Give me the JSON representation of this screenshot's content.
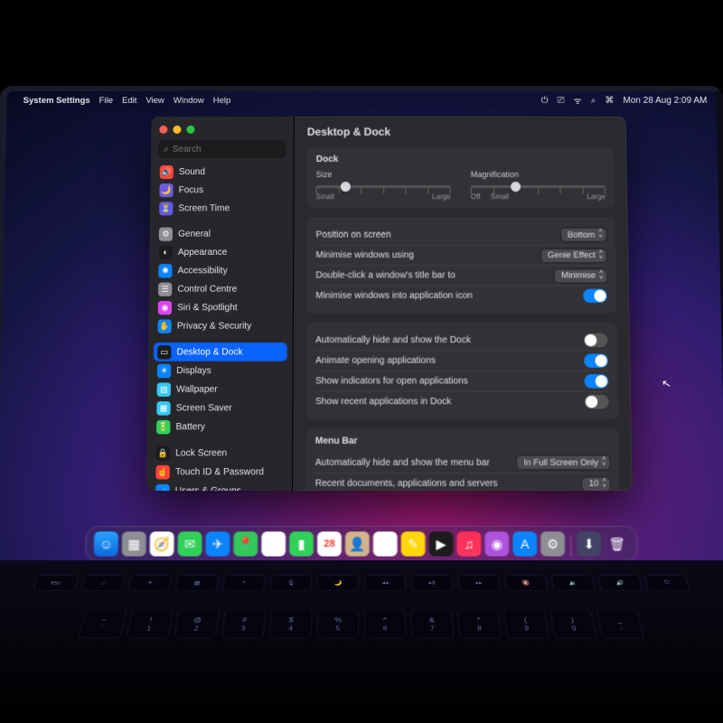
{
  "menubar": {
    "app_name": "System Settings",
    "items": [
      "File",
      "Edit",
      "View",
      "Window",
      "Help"
    ],
    "clock": "Mon 28 Aug  2:09 AM"
  },
  "window": {
    "title": "Desktop & Dock",
    "search_placeholder": "Search"
  },
  "sidebar": {
    "groups": [
      [
        {
          "label": "Sound",
          "color": "#ff453a",
          "glyph": "🔊"
        },
        {
          "label": "Focus",
          "color": "#6e5ce6",
          "glyph": "🌙"
        },
        {
          "label": "Screen Time",
          "color": "#5e5ce6",
          "glyph": "⏳"
        }
      ],
      [
        {
          "label": "General",
          "color": "#8e8e93",
          "glyph": "⚙"
        },
        {
          "label": "Appearance",
          "color": "#1c1c1e",
          "glyph": "◐"
        },
        {
          "label": "Accessibility",
          "color": "#0a84ff",
          "glyph": "✺"
        },
        {
          "label": "Control Centre",
          "color": "#8e8e93",
          "glyph": "☰"
        },
        {
          "label": "Siri & Spotlight",
          "color": "#d946ef",
          "glyph": "◉"
        },
        {
          "label": "Privacy & Security",
          "color": "#0a84ff",
          "glyph": "✋"
        }
      ],
      [
        {
          "label": "Desktop & Dock",
          "color": "#1c1c1e",
          "glyph": "▭",
          "selected": true
        },
        {
          "label": "Displays",
          "color": "#0a84ff",
          "glyph": "☀"
        },
        {
          "label": "Wallpaper",
          "color": "#34c7f5",
          "glyph": "▧"
        },
        {
          "label": "Screen Saver",
          "color": "#34c7f5",
          "glyph": "▦"
        },
        {
          "label": "Battery",
          "color": "#30d158",
          "glyph": "🔋"
        }
      ],
      [
        {
          "label": "Lock Screen",
          "color": "#1c1c1e",
          "glyph": "🔒"
        },
        {
          "label": "Touch ID & Password",
          "color": "#ff453a",
          "glyph": "☝"
        },
        {
          "label": "Users & Groups",
          "color": "#0a84ff",
          "glyph": "👥"
        }
      ]
    ]
  },
  "dock_section": {
    "heading": "Dock",
    "size": {
      "label": "Size",
      "min": "Small",
      "max": "Large",
      "pos": 18
    },
    "mag": {
      "label": "Magnification",
      "min_off": "Off",
      "min": "Small",
      "max": "Large",
      "pos": 30
    }
  },
  "rows1": [
    {
      "label": "Position on screen",
      "value": "Bottom",
      "type": "popup"
    },
    {
      "label": "Minimise windows using",
      "value": "Genie Effect",
      "type": "popup"
    },
    {
      "label": "Double-click a window's title bar to",
      "value": "Minimise",
      "type": "popup"
    },
    {
      "label": "Minimise windows into application icon",
      "on": true,
      "type": "toggle"
    }
  ],
  "rows2": [
    {
      "label": "Automatically hide and show the Dock",
      "on": false,
      "type": "toggle"
    },
    {
      "label": "Animate opening applications",
      "on": true,
      "type": "toggle"
    },
    {
      "label": "Show indicators for open applications",
      "on": true,
      "type": "toggle"
    },
    {
      "label": "Show recent applications in Dock",
      "on": false,
      "type": "toggle"
    }
  ],
  "menubar_section": {
    "heading": "Menu Bar",
    "rows": [
      {
        "label": "Automatically hide and show the menu bar",
        "value": "In Full Screen Only",
        "type": "popup"
      },
      {
        "label": "Recent documents, applications and servers",
        "value": "10",
        "type": "popup"
      }
    ]
  },
  "dock_apps": [
    {
      "name": "finder",
      "bg": "linear-gradient(#29a3ff,#0a6be0)",
      "glyph": "☺"
    },
    {
      "name": "launchpad",
      "bg": "#8e8e93",
      "glyph": "▦"
    },
    {
      "name": "safari",
      "bg": "#ffffff",
      "glyph": "🧭"
    },
    {
      "name": "messages",
      "bg": "#30d158",
      "glyph": "✉"
    },
    {
      "name": "mail",
      "bg": "#0a84ff",
      "glyph": "✈"
    },
    {
      "name": "maps",
      "bg": "#34c759",
      "glyph": "📍"
    },
    {
      "name": "photos",
      "bg": "#ffffff",
      "glyph": "✿"
    },
    {
      "name": "facetime",
      "bg": "#30d158",
      "glyph": "▮"
    },
    {
      "name": "calendar",
      "bg": "#ffffff",
      "glyph": "28"
    },
    {
      "name": "contacts",
      "bg": "#d2b48c",
      "glyph": "👤"
    },
    {
      "name": "reminders",
      "bg": "#ffffff",
      "glyph": "☑"
    },
    {
      "name": "notes",
      "bg": "#ffd60a",
      "glyph": "✎"
    },
    {
      "name": "tv",
      "bg": "#1c1c1e",
      "glyph": "▶"
    },
    {
      "name": "music",
      "bg": "linear-gradient(#ff2d55,#ff375f)",
      "glyph": "♫"
    },
    {
      "name": "podcasts",
      "bg": "#af52de",
      "glyph": "◉"
    },
    {
      "name": "appstore",
      "bg": "#0a84ff",
      "glyph": "A"
    },
    {
      "name": "settings",
      "bg": "#8e8e93",
      "glyph": "⚙"
    }
  ],
  "dock_right": [
    {
      "name": "downloads",
      "bg": "#434366",
      "glyph": "⬇"
    },
    {
      "name": "trash",
      "bg": "transparent",
      "glyph": "🗑"
    }
  ]
}
